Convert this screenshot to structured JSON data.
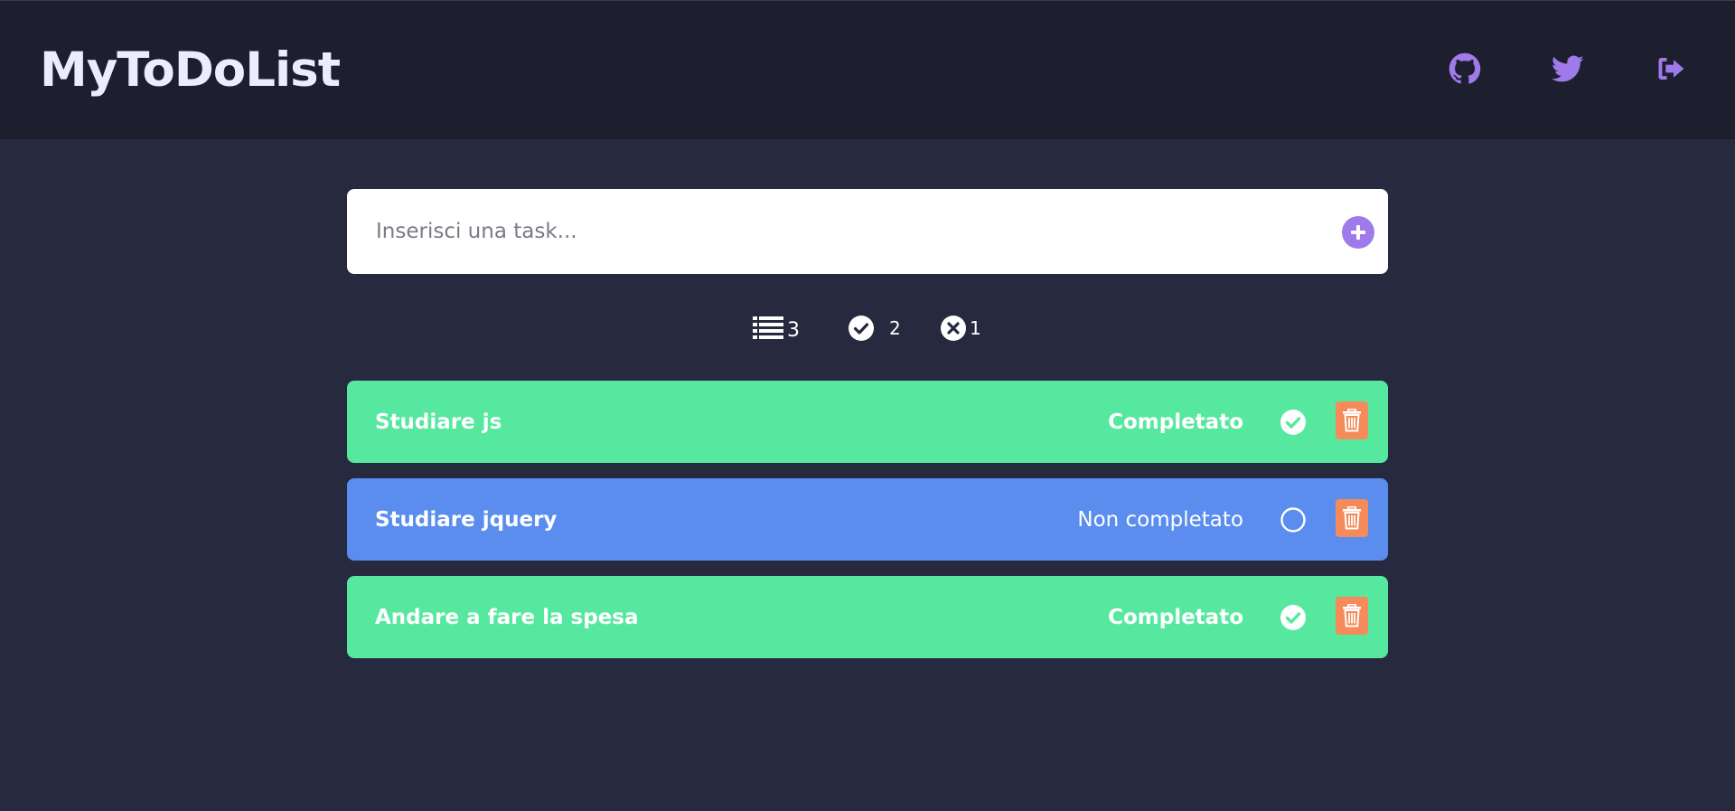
{
  "app": {
    "title": "MyToDoList"
  },
  "header": {
    "icons": [
      "github-icon",
      "twitter-icon",
      "logout-icon"
    ],
    "icon_color": "#9f7aea"
  },
  "input": {
    "placeholder": "Inserisci una task...",
    "value": ""
  },
  "stats": {
    "total": "3",
    "completed": "2",
    "not_completed": "1"
  },
  "tasks": [
    {
      "title": "Studiare js",
      "status": "Completato",
      "done": true
    },
    {
      "title": "Studiare jquery",
      "status": "Non completato",
      "done": false
    },
    {
      "title": "Andare a fare la spesa",
      "status": "Completato",
      "done": true
    }
  ],
  "colors": {
    "background": "#272a3f",
    "header": "#1e1f2e",
    "completed": "#57e8a0",
    "pending": "#5b8def",
    "delete": "#f58a5a",
    "accent": "#9f7aea"
  }
}
